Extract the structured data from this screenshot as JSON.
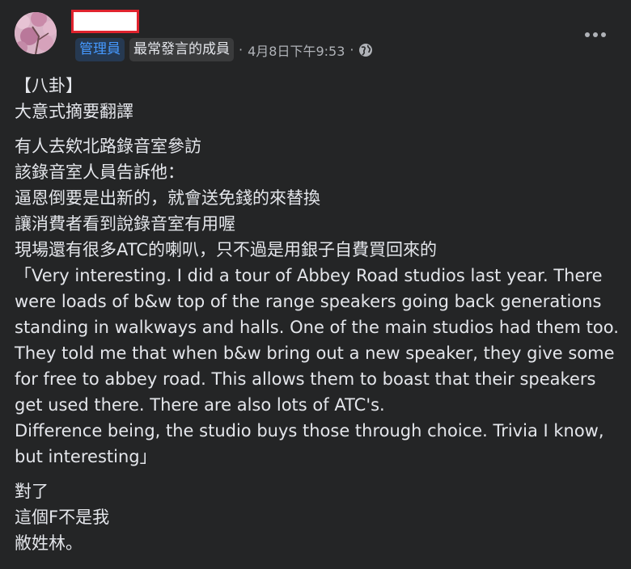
{
  "post": {
    "badges": {
      "admin": "管理員",
      "top_contributor": "最常發言的成員"
    },
    "separator": "·",
    "timestamp": "4月8日下午9:53",
    "privacy_icon": "globe-icon",
    "more_icon": "more-options-icon",
    "paragraphs": [
      [
        "【八卦】",
        "大意式摘要翻譯"
      ],
      [
        "有人去欸北路錄音室參訪",
        "該錄音室人員告訴他：",
        "逼恩倒要是出新的，就會送免錢的來替換",
        "讓消費者看到說錄音室有用喔",
        "現場還有很多ATC的喇叭，只不過是用銀子自費買回來的",
        "「Very interesting. I did a tour of Abbey Road studios last year. There",
        "were loads of b&w top of the range speakers going back generations",
        "standing in walkways and halls. One of the main studios had them too.",
        "They told me that when b&w bring out a new speaker, they give some",
        "for free to abbey road. This allows them to boast that their speakers",
        "get used there. There are also lots of ATC's.",
        "Difference being, the studio buys those through choice. Trivia I know,",
        "but interesting」"
      ],
      [
        "對了",
        "這個F不是我",
        "敝姓林。"
      ]
    ]
  },
  "colors": {
    "background": "#242526",
    "text": "#e4e6eb",
    "secondary_text": "#b0b3b8",
    "admin_badge_bg": "#263951",
    "admin_badge_text": "#4599ff",
    "badge_bg": "#3a3b3c",
    "redaction_border": "#e0232e"
  }
}
